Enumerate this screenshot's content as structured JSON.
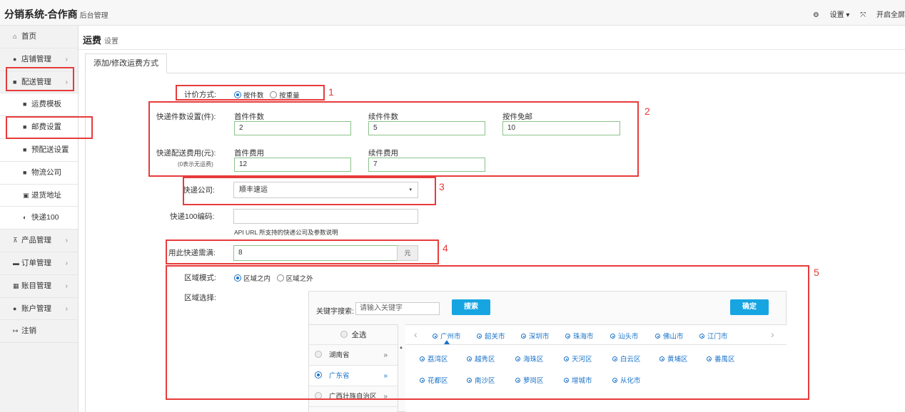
{
  "header": {
    "brand": "分销系统-合作商",
    "brand_sub": "后台管理",
    "settings": "设置",
    "open_full": "开启全屏"
  },
  "sidebar": {
    "items": [
      {
        "icon": "home-icon",
        "label": "首页"
      },
      {
        "icon": "user-icon",
        "label": "店铺管理",
        "chev": "›"
      },
      {
        "icon": "truck-icon",
        "label": "配送管理",
        "chev": "›"
      },
      {
        "icon": "truck-icon",
        "label": "运费模板"
      },
      {
        "icon": "truck-icon",
        "label": "邮费设置"
      },
      {
        "icon": "truck-icon",
        "label": "预配送设置"
      },
      {
        "icon": "truck-icon",
        "label": "物流公司"
      },
      {
        "icon": "return-icon",
        "label": "退货地址"
      },
      {
        "icon": "globe-icon",
        "label": "快递100"
      },
      {
        "icon": "cart-icon",
        "label": "产品管理",
        "chev": "›"
      },
      {
        "icon": "order-icon",
        "label": "订单管理",
        "chev": "›"
      },
      {
        "icon": "table-icon",
        "label": "账目管理",
        "chev": "›"
      },
      {
        "icon": "user-icon",
        "label": "账户管理",
        "chev": "›"
      },
      {
        "icon": "logout-icon",
        "label": "注销"
      }
    ]
  },
  "page": {
    "title": "运费",
    "subtitle": "设置",
    "tab": "添加/修改运费方式"
  },
  "form": {
    "pricing_label": "计价方式:",
    "pricing_options": [
      "按件数",
      "按重量"
    ],
    "count_label": "快递件数设置(件):",
    "first_count_label": "首件件数",
    "first_count": "2",
    "extra_count_label": "续件件数",
    "extra_count": "5",
    "free_label": "按件免邮",
    "free_value": "10",
    "fee_label": "快递配送费用(元):",
    "fee_note": "(0表示无运费)",
    "first_fee_label": "首件费用",
    "first_fee": "12",
    "extra_fee_label": "续件费用",
    "extra_fee": "7",
    "company_label": "快递公司:",
    "company_value": "顺丰速运",
    "kd100_label": "快递100编码:",
    "kd100_value": "",
    "kd100_help": "API URL 所支持的快递公司及参数说明",
    "min_label": "用此快递需满:",
    "min_value": "8",
    "min_unit": "元",
    "region_mode_label": "区域模式:",
    "region_mode_options": [
      "区域之内",
      "区域之外"
    ],
    "region_select_label": "区域选择:"
  },
  "picker": {
    "keyword_label": "关键字搜索:",
    "keyword_placeholder": "请输入关键字",
    "search_button": "搜索",
    "confirm_button": "确定",
    "select_all": "全选",
    "provinces": [
      "湖南省",
      "广东省",
      "广西壮族自治区"
    ],
    "cities": [
      "广州市",
      "韶关市",
      "深圳市",
      "珠海市",
      "汕头市",
      "佛山市",
      "江门市"
    ],
    "districts_row1": [
      "荔湾区",
      "越秀区",
      "海珠区",
      "天河区",
      "白云区",
      "黄埔区",
      "番禺区"
    ],
    "districts_row2": [
      "花都区",
      "南沙区",
      "萝岗区",
      "增城市",
      "从化市"
    ]
  },
  "annotations": [
    "1",
    "2",
    "3",
    "4",
    "5"
  ]
}
